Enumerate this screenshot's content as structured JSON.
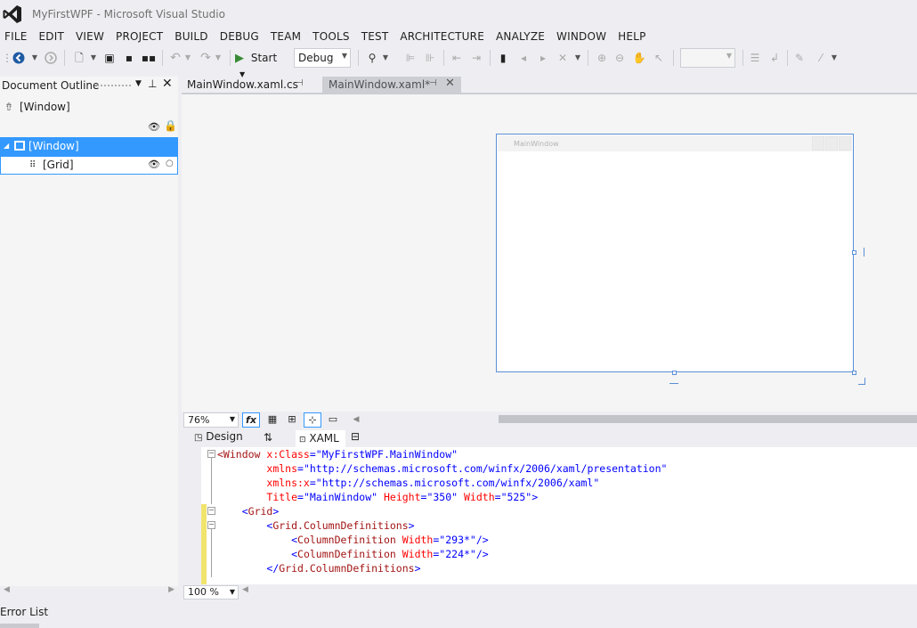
{
  "window": {
    "title": "MyFirstWPF - Microsoft Visual Studio"
  },
  "menu": [
    "FILE",
    "EDIT",
    "VIEW",
    "PROJECT",
    "BUILD",
    "DEBUG",
    "TEAM",
    "TOOLS",
    "TEST",
    "ARCHITECTURE",
    "ANALYZE",
    "WINDOW",
    "HELP"
  ],
  "toolbar": {
    "start_label": "Start",
    "config_value": "Debug",
    "accent": "#388a34"
  },
  "outline": {
    "title": "Document Outline",
    "root": "[Window]",
    "items": [
      {
        "label": "[Window]",
        "selected": true
      },
      {
        "label": "[Grid]",
        "selected": false
      }
    ],
    "selected_color": "#3399ff"
  },
  "tabs": [
    {
      "label": "MainWindow.xaml.cs",
      "active": false
    },
    {
      "label": "MainWindow.xaml*",
      "active": true
    }
  ],
  "designer": {
    "window_title": "MainWindow",
    "zoom": "76%"
  },
  "split": {
    "design_label": "Design",
    "xaml_label": "XAML"
  },
  "code": [
    [
      {
        "c": "t-br",
        "t": "<Window "
      },
      {
        "c": "t-at",
        "t": "x:Class"
      },
      {
        "c": "t-p",
        "t": "="
      },
      {
        "c": "t-v",
        "t": "\"MyFirstWPF.MainWindow\""
      }
    ],
    [
      {
        "c": "",
        "t": "        "
      },
      {
        "c": "t-at",
        "t": "xmlns"
      },
      {
        "c": "t-p",
        "t": "="
      },
      {
        "c": "t-v",
        "t": "\"http://schemas.microsoft.com/winfx/2006/xaml/presentation\""
      }
    ],
    [
      {
        "c": "",
        "t": "        "
      },
      {
        "c": "t-at",
        "t": "xmlns:x"
      },
      {
        "c": "t-p",
        "t": "="
      },
      {
        "c": "t-v",
        "t": "\"http://schemas.microsoft.com/winfx/2006/xaml\""
      }
    ],
    [
      {
        "c": "",
        "t": "        "
      },
      {
        "c": "t-at",
        "t": "Title"
      },
      {
        "c": "t-p",
        "t": "="
      },
      {
        "c": "t-v",
        "t": "\"MainWindow\""
      },
      {
        "c": "t-at",
        "t": " Height"
      },
      {
        "c": "t-p",
        "t": "="
      },
      {
        "c": "t-v",
        "t": "\"350\""
      },
      {
        "c": "t-at",
        "t": " Width"
      },
      {
        "c": "t-p",
        "t": "="
      },
      {
        "c": "t-v",
        "t": "\"525\""
      },
      {
        "c": "t-v",
        "t": ">"
      }
    ],
    [
      {
        "c": "",
        "t": "    "
      },
      {
        "c": "t-v",
        "t": "<"
      },
      {
        "c": "t-br",
        "t": "Grid"
      },
      {
        "c": "t-v",
        "t": ">"
      }
    ],
    [
      {
        "c": "",
        "t": "        "
      },
      {
        "c": "t-v",
        "t": "<"
      },
      {
        "c": "t-br",
        "t": "Grid.ColumnDefinitions"
      },
      {
        "c": "t-v",
        "t": ">"
      }
    ],
    [
      {
        "c": "",
        "t": "            "
      },
      {
        "c": "t-v",
        "t": "<"
      },
      {
        "c": "t-br",
        "t": "ColumnDefinition"
      },
      {
        "c": "t-at",
        "t": " Width"
      },
      {
        "c": "t-p",
        "t": "="
      },
      {
        "c": "t-v",
        "t": "\"293*\""
      },
      {
        "c": "t-v",
        "t": "/>"
      }
    ],
    [
      {
        "c": "",
        "t": "            "
      },
      {
        "c": "t-v",
        "t": "<"
      },
      {
        "c": "t-br",
        "t": "ColumnDefinition"
      },
      {
        "c": "t-at",
        "t": " Width"
      },
      {
        "c": "t-p",
        "t": "="
      },
      {
        "c": "t-v",
        "t": "\"224*\""
      },
      {
        "c": "t-v",
        "t": "/>"
      }
    ],
    [
      {
        "c": "",
        "t": "        "
      },
      {
        "c": "t-v",
        "t": "</"
      },
      {
        "c": "t-br",
        "t": "Grid.ColumnDefinitions"
      },
      {
        "c": "t-v",
        "t": ">"
      }
    ]
  ],
  "editor_zoom": "100 %",
  "bottom_panel": {
    "label": "Error List"
  }
}
